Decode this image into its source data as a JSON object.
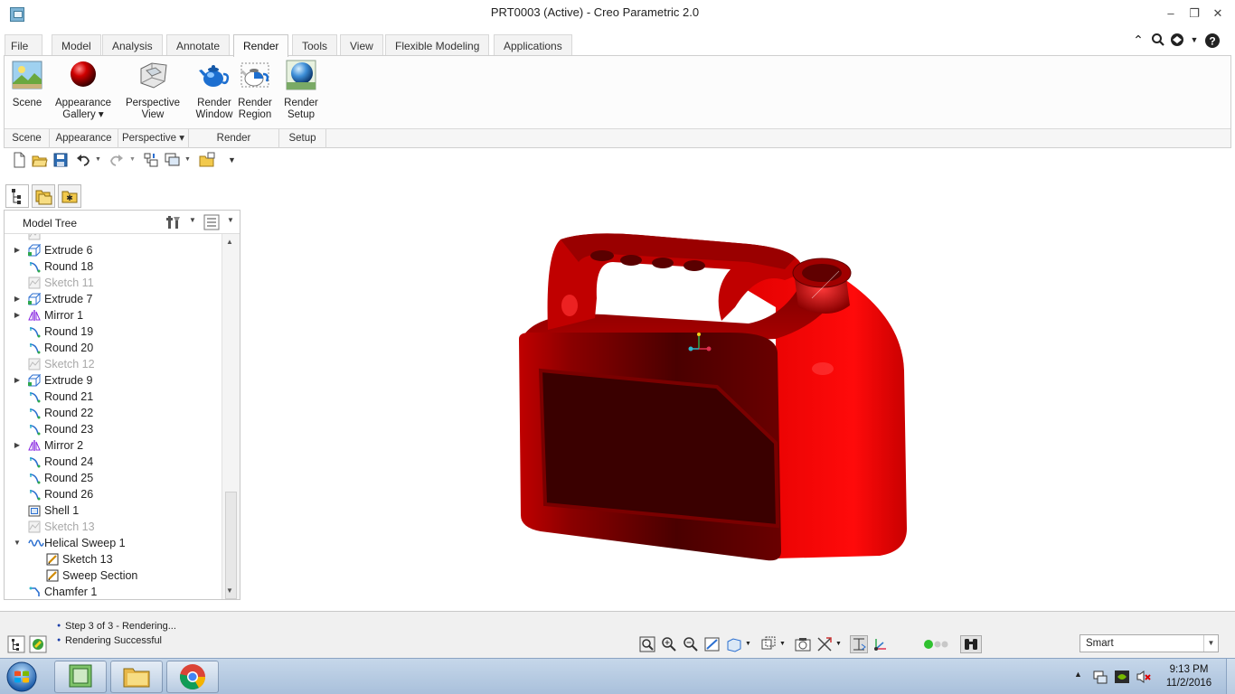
{
  "window": {
    "title": "PRT0003 (Active) - Creo Parametric 2.0",
    "minimize": "–",
    "restore": "❐",
    "close": "✕"
  },
  "tabs": [
    {
      "label": "File ▾"
    },
    {
      "label": "Model"
    },
    {
      "label": "Analysis"
    },
    {
      "label": "Annotate"
    },
    {
      "label": "Render"
    },
    {
      "label": "Tools"
    },
    {
      "label": "View"
    },
    {
      "label": "Flexible Modeling"
    },
    {
      "label": "Applications"
    }
  ],
  "active_tab": "Render",
  "ribbon": {
    "buttons": [
      {
        "line1": "Scene",
        "line2": "",
        "icon": "scene-icon"
      },
      {
        "line1": "Appearance",
        "line2": "Gallery ▾",
        "icon": "appearance-sphere-icon"
      },
      {
        "line1": "Perspective",
        "line2": "View",
        "icon": "perspective-view-icon"
      },
      {
        "line1": "Render",
        "line2": "Window",
        "icon": "teapot-icon"
      },
      {
        "line1": "Render",
        "line2": "Region",
        "icon": "teapot-region-icon"
      },
      {
        "line1": "Render",
        "line2": "Setup",
        "icon": "render-setup-icon"
      }
    ],
    "groups": [
      {
        "label": "Scene"
      },
      {
        "label": "Appearance"
      },
      {
        "label": "Perspective ▾"
      },
      {
        "label": "Render"
      },
      {
        "label": "Setup"
      }
    ]
  },
  "model_tree": {
    "title": "Model Tree",
    "rows": [
      {
        "label": "Extrude 6",
        "type": "extrude",
        "expander": "▶",
        "indent": 0,
        "dim": false
      },
      {
        "label": "Round 18",
        "type": "round",
        "expander": "",
        "indent": 0,
        "dim": false
      },
      {
        "label": "Sketch 11",
        "type": "sketch",
        "expander": "",
        "indent": 0,
        "dim": true
      },
      {
        "label": "Extrude 7",
        "type": "extrude",
        "expander": "▶",
        "indent": 0,
        "dim": false
      },
      {
        "label": "Mirror 1",
        "type": "mirror",
        "expander": "▶",
        "indent": 0,
        "dim": false
      },
      {
        "label": "Round 19",
        "type": "round",
        "expander": "",
        "indent": 0,
        "dim": false
      },
      {
        "label": "Round 20",
        "type": "round",
        "expander": "",
        "indent": 0,
        "dim": false
      },
      {
        "label": "Sketch 12",
        "type": "sketch",
        "expander": "",
        "indent": 0,
        "dim": true
      },
      {
        "label": "Extrude 9",
        "type": "extrude",
        "expander": "▶",
        "indent": 0,
        "dim": false
      },
      {
        "label": "Round 21",
        "type": "round",
        "expander": "",
        "indent": 0,
        "dim": false
      },
      {
        "label": "Round 22",
        "type": "round",
        "expander": "",
        "indent": 0,
        "dim": false
      },
      {
        "label": "Round 23",
        "type": "round",
        "expander": "",
        "indent": 0,
        "dim": false
      },
      {
        "label": "Mirror 2",
        "type": "mirror",
        "expander": "▶",
        "indent": 0,
        "dim": false
      },
      {
        "label": "Round 24",
        "type": "round",
        "expander": "",
        "indent": 0,
        "dim": false
      },
      {
        "label": "Round 25",
        "type": "round",
        "expander": "",
        "indent": 0,
        "dim": false
      },
      {
        "label": "Round 26",
        "type": "round",
        "expander": "",
        "indent": 0,
        "dim": false
      },
      {
        "label": "Shell 1",
        "type": "shell",
        "expander": "",
        "indent": 0,
        "dim": false
      },
      {
        "label": "Sketch 13",
        "type": "sketch",
        "expander": "",
        "indent": 0,
        "dim": true
      },
      {
        "label": "Helical Sweep 1",
        "type": "helical",
        "expander": "▼",
        "indent": 0,
        "dim": false
      },
      {
        "label": "Sketch 13",
        "type": "sketch-edit",
        "expander": "",
        "indent": 1,
        "dim": false
      },
      {
        "label": "Sweep Section",
        "type": "sketch-edit",
        "expander": "",
        "indent": 1,
        "dim": false
      },
      {
        "label": "Chamfer 1",
        "type": "chamfer",
        "expander": "",
        "indent": 0,
        "dim": false
      }
    ]
  },
  "status": {
    "messages": [
      "Step 3 of 3 - Rendering...",
      "Rendering Successful"
    ],
    "filter": "Smart"
  },
  "taskbar": {
    "time": "9:13 PM",
    "date": "11/2/2016"
  },
  "colors": {
    "model_red": "#c80000",
    "accent_blue": "#1c3fa8"
  }
}
